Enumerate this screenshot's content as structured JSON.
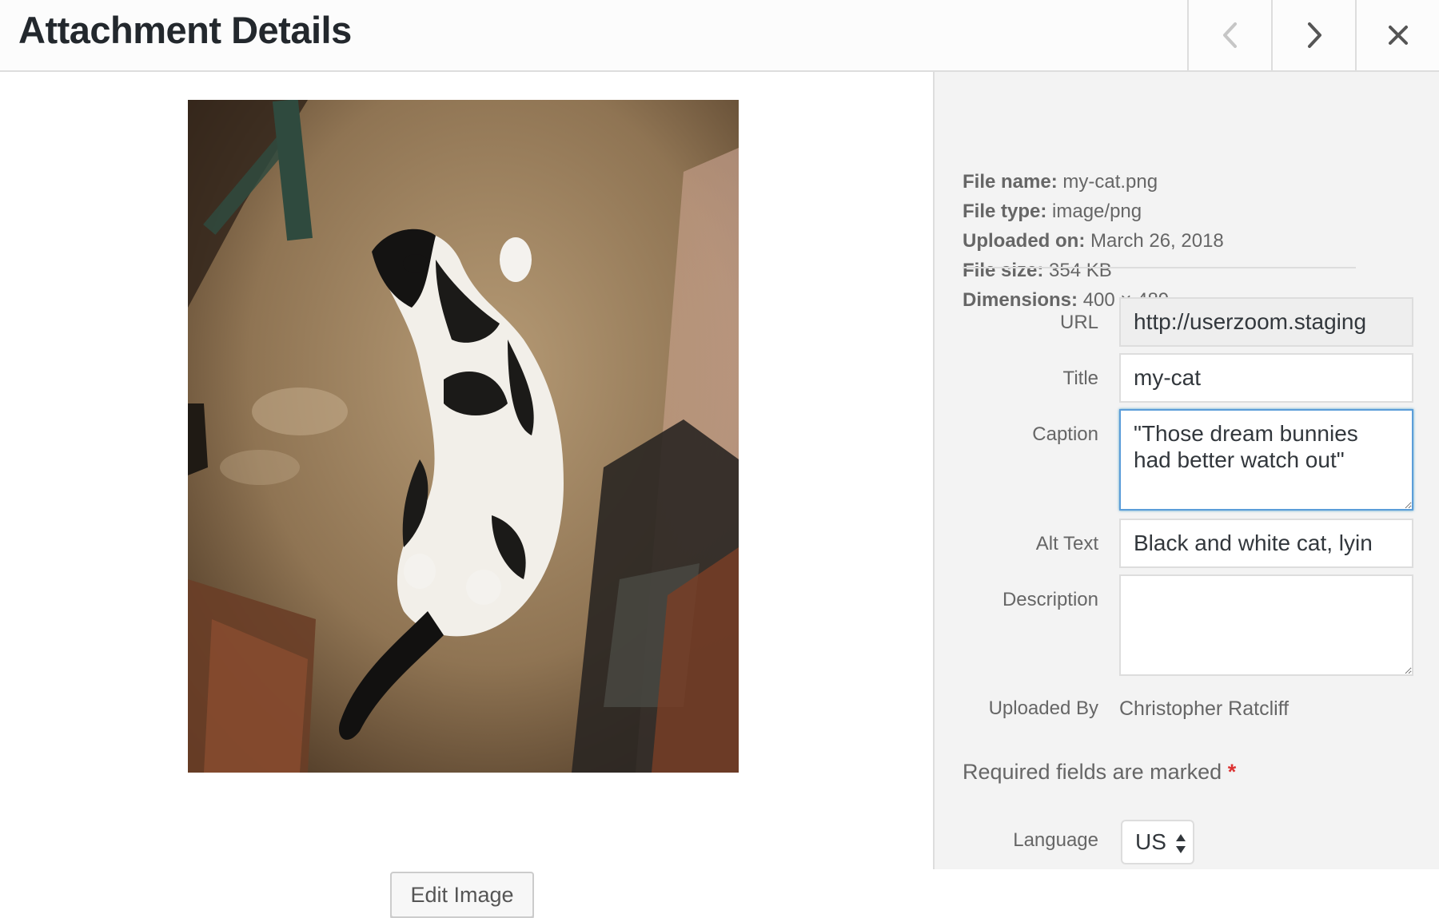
{
  "header": {
    "title": "Attachment Details",
    "prev_icon": "chevron-left-icon",
    "next_icon": "chevron-right-icon",
    "close_icon": "close-icon"
  },
  "preview": {
    "image_description_icon": "cat-photo",
    "edit_button_label": "Edit Image"
  },
  "details": {
    "file_name_label": "File name:",
    "file_name": "my-cat.png",
    "file_type_label": "File type:",
    "file_type": "image/png",
    "uploaded_on_label": "Uploaded on:",
    "uploaded_on": "March 26, 2018",
    "file_size_label": "File size:",
    "file_size": "354 KB",
    "dimensions_label": "Dimensions:",
    "dimensions": "400 × 489"
  },
  "fields": {
    "url_label": "URL",
    "url_value": "http://userzoom.staging",
    "title_label": "Title",
    "title_value": "my-cat",
    "caption_label": "Caption",
    "caption_value": "\"Those dream bunnies had better watch out\"",
    "alt_label": "Alt Text",
    "alt_value": "Black and white cat, lyin",
    "description_label": "Description",
    "description_value": "",
    "uploaded_by_label": "Uploaded By",
    "uploaded_by_value": "Christopher Ratcliff"
  },
  "required_note": "Required fields are marked",
  "required_star": "*",
  "language": {
    "label": "Language",
    "selected": "US"
  },
  "colors": {
    "focus_border": "#5b9dd9",
    "required": "#dc3232",
    "sidebar_bg": "#f3f3f3"
  }
}
